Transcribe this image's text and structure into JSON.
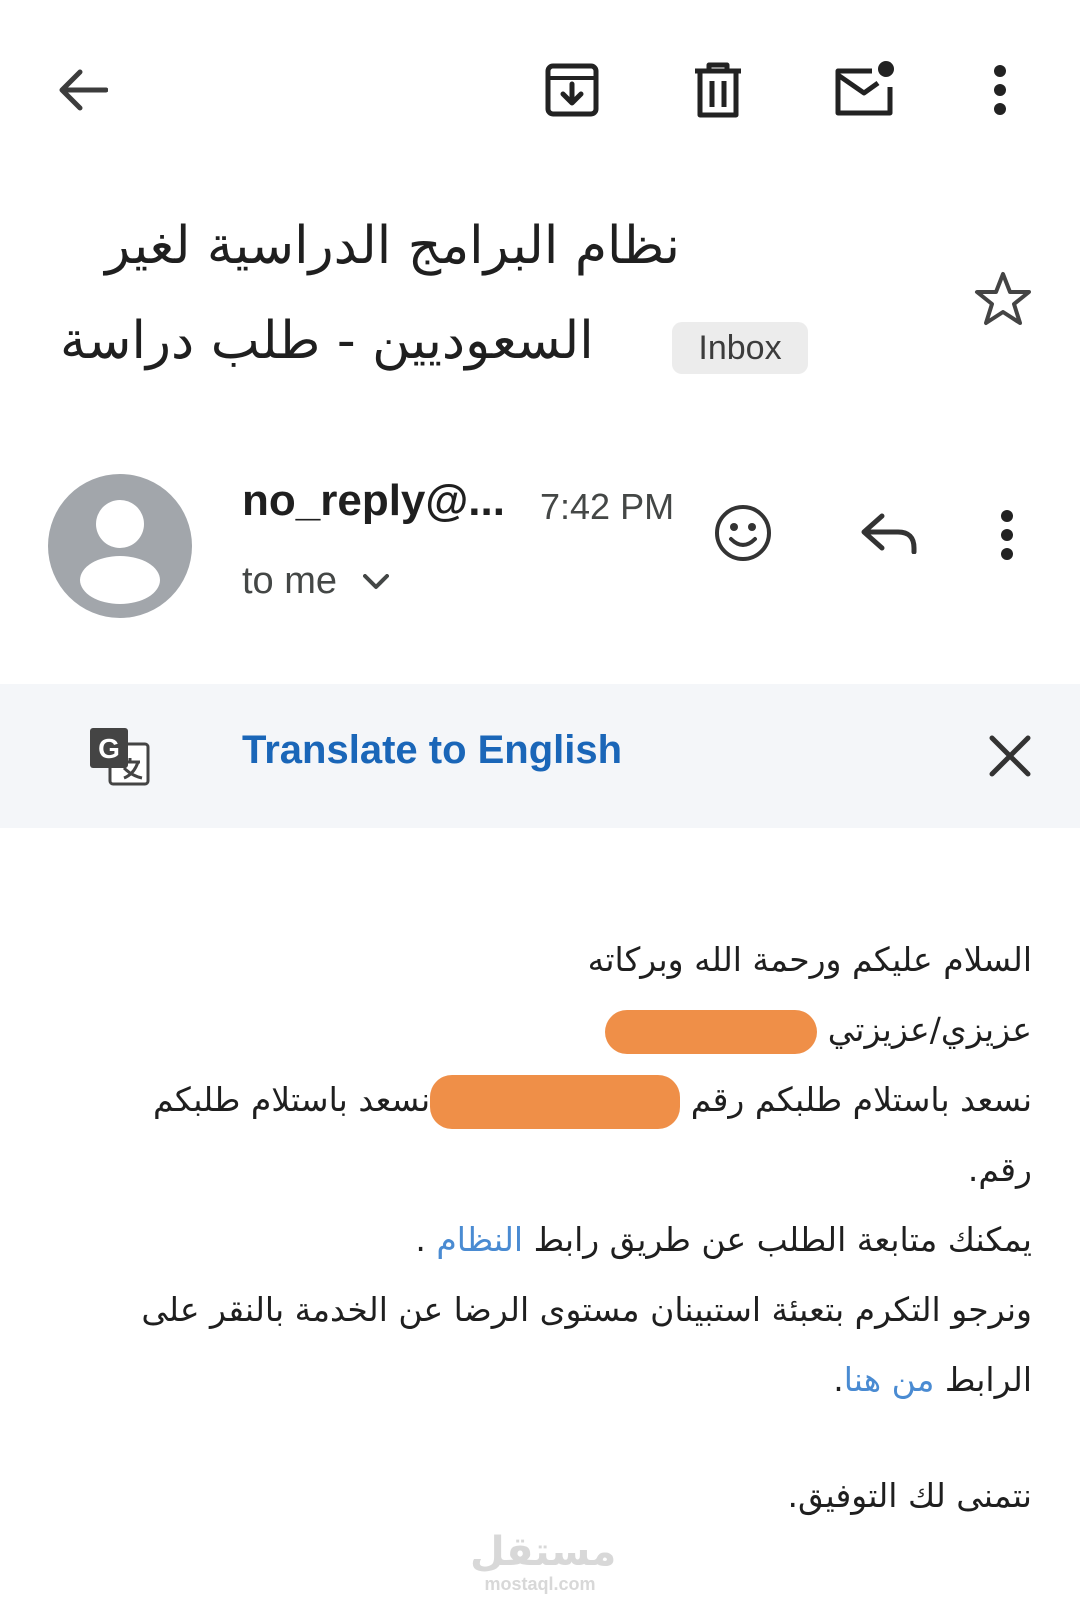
{
  "toolbar": {
    "back_icon": "arrow-back-icon",
    "archive_icon": "archive-icon",
    "delete_icon": "trash-icon",
    "mark_unread_icon": "mark-unread-icon",
    "more_icon": "more-vert-icon"
  },
  "email": {
    "subject_line1": "نظام البرامج الدراسية لغير",
    "subject_line2": "السعوديين - طلب دراسة",
    "label": "Inbox",
    "starred": false
  },
  "sender": {
    "name": "no_reply@...",
    "time": "7:42 PM",
    "recipient": "to me"
  },
  "translate": {
    "label": "Translate to English"
  },
  "body": {
    "greeting": "السلام عليكم ورحمة الله وبركاته",
    "salutation": "عزيزي/عزيزتي",
    "line1_part1": "نسعد باستلام طلبكم رقم",
    "line1_part2": "نسعد باستلام طلبكم",
    "line1_part3": "رقم.",
    "line2_text": "يمكنك متابعة الطلب عن طريق رابط",
    "line2_link": "النظام",
    "line2_end": " .",
    "line3_text": "ونرجو التكرم بتعبئة استبينان مستوى الرضا عن الخدمة بالنقر على الرابط",
    "line3_link": "من هنا",
    "line3_end": ".",
    "closing": "نتمنى لك التوفيق."
  },
  "watermark": {
    "arabic": "مستقل",
    "latin": "mostaql.com"
  },
  "colors": {
    "link": "#4a8bd2",
    "translate": "#1a66b8",
    "redaction": "#ef8f48",
    "avatar": "#a2a6ab",
    "translate_bar_bg": "#f4f6f9"
  }
}
